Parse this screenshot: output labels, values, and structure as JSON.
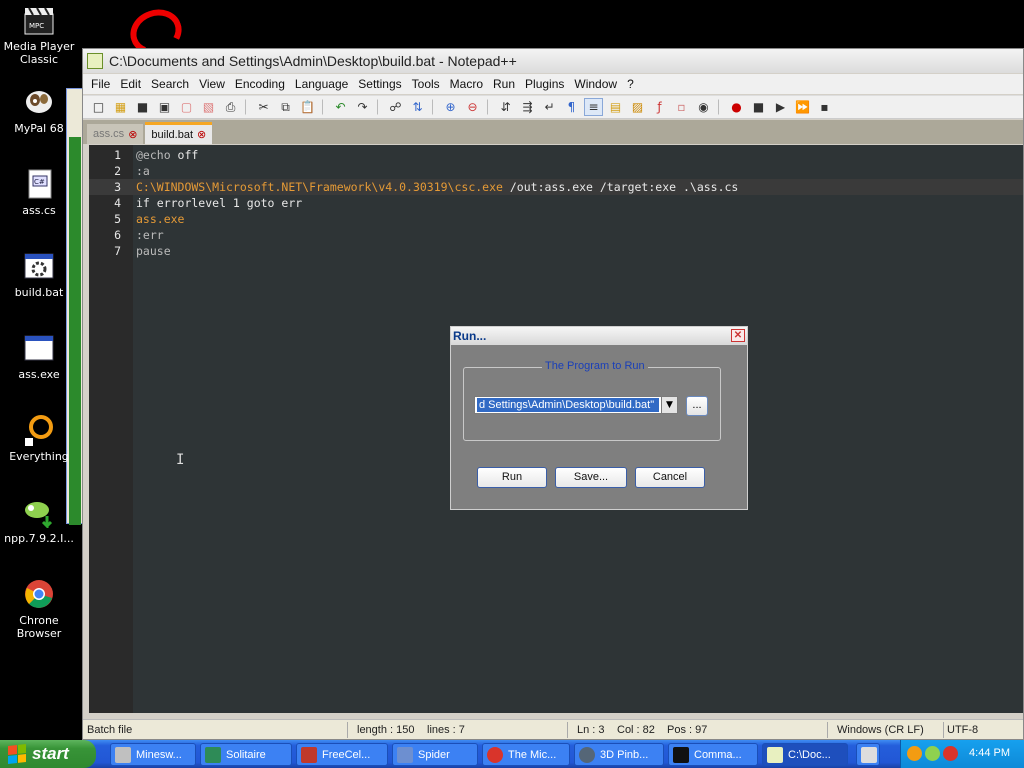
{
  "desktop": {
    "icons": [
      {
        "label": "Media Player Classic"
      },
      {
        "label": "MyPal 68"
      },
      {
        "label": "ass.cs"
      },
      {
        "label": "build.bat"
      },
      {
        "label": "ass.exe"
      },
      {
        "label": "Everything"
      },
      {
        "label": "npp.7.9.2.I..."
      },
      {
        "label": "Chrone Browser"
      }
    ]
  },
  "window": {
    "title": "C:\\Documents and Settings\\Admin\\Desktop\\build.bat - Notepad++",
    "menu": [
      "File",
      "Edit",
      "Search",
      "View",
      "Encoding",
      "Language",
      "Settings",
      "Tools",
      "Macro",
      "Run",
      "Plugins",
      "Window",
      "?"
    ],
    "tabs": [
      {
        "label": "ass.cs",
        "active": false
      },
      {
        "label": "build.bat",
        "active": true
      }
    ],
    "code": [
      {
        "num": "1",
        "parts": [
          "@echo",
          " off"
        ]
      },
      {
        "num": "2",
        "parts": [
          ":a"
        ]
      },
      {
        "num": "3",
        "parts": [
          "C:\\WINDOWS\\Microsoft.NET\\Framework\\v4.0.30319\\csc.exe",
          " /out:ass.exe /target:exe .\\ass.cs"
        ]
      },
      {
        "num": "4",
        "parts": [
          "if errorlevel 1 goto err"
        ]
      },
      {
        "num": "5",
        "parts": [
          "ass.exe"
        ]
      },
      {
        "num": "6",
        "parts": [
          ":err"
        ]
      },
      {
        "num": "7",
        "parts": [
          "pause"
        ]
      }
    ],
    "status": {
      "filetype": "Batch file",
      "length": "length : 150",
      "lines": "lines : 7",
      "ln": "Ln : 3",
      "col": "Col : 82",
      "pos": "Pos : 97",
      "eol": "Windows (CR LF)",
      "encoding": "UTF-8"
    }
  },
  "run_dialog": {
    "title": "Run...",
    "group_label": "The Program to Run",
    "program_value": "d Settings\\Admin\\Desktop\\build.bat\"",
    "browse_label": "...",
    "run_label": "Run",
    "save_label": "Save...",
    "cancel_label": "Cancel"
  },
  "taskbar": {
    "start_label": "start",
    "tasks": [
      {
        "label": "Minesw...",
        "color": "#c0c0c0"
      },
      {
        "label": "Solitaire",
        "color": "#2e8b57"
      },
      {
        "label": "FreeCel...",
        "color": "#c0392b"
      },
      {
        "label": "Spider",
        "color": "#6d8fd0"
      },
      {
        "label": "The Mic...",
        "color": "#d9342b"
      },
      {
        "label": "3D Pinb...",
        "color": "#556677"
      },
      {
        "label": "Comma...",
        "color": "#111111"
      },
      {
        "label": "C:\\Doc...",
        "color": "#e8f0c0"
      }
    ],
    "clock": "4:44 PM"
  }
}
